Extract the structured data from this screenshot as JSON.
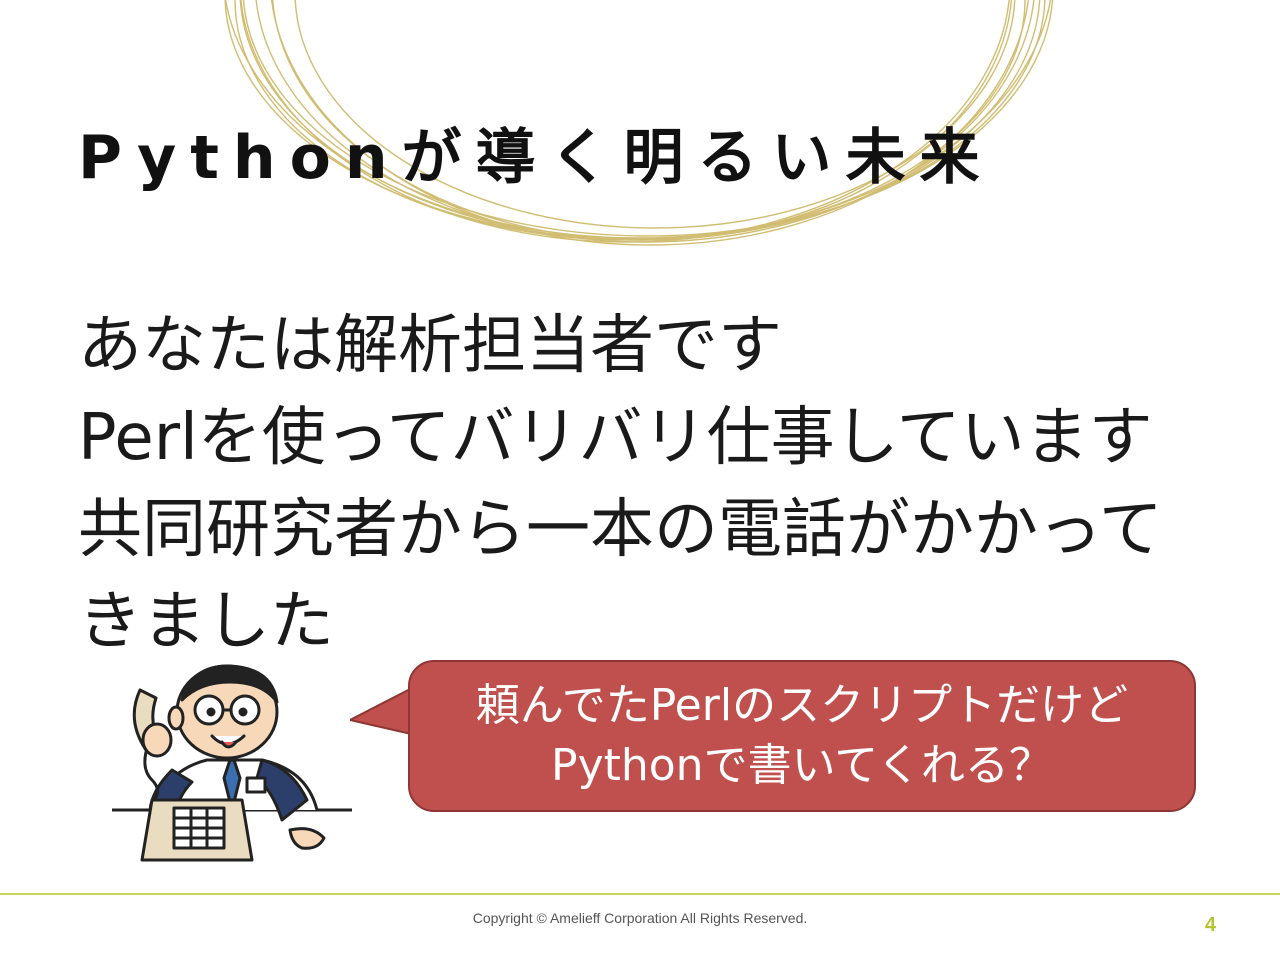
{
  "slide": {
    "title": "Pythonが導く明るい未来",
    "body_lines": [
      "あなたは解析担当者です",
      "Perlを使ってバリバリ仕事しています",
      "共同研究者から一本の電話がかかって",
      "きました"
    ],
    "speech_bubble": {
      "lines": [
        "頼んでたPerlのスクリプトだけど",
        "Pythonで書いてくれる？"
      ]
    }
  },
  "footer": {
    "copyright": "Copyright © Amelieff Corporation All Rights Reserved.",
    "page_number": "4"
  },
  "colors": {
    "bubble_fill": "#c0504d",
    "ring_gold": "#c9b25a",
    "footer_rule": "#c8d65a",
    "page_number": "#b5c432"
  },
  "icons": {
    "illustration": "man-on-phone-illustration",
    "decoration": "gold-rings-decoration"
  }
}
